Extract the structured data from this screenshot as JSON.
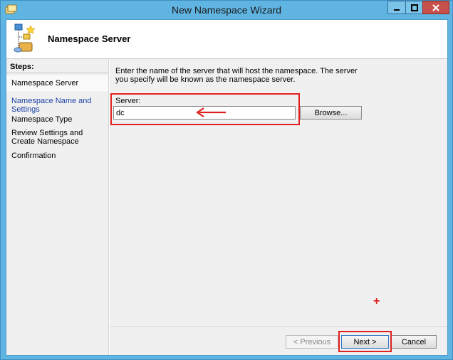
{
  "window": {
    "title": "New Namespace Wizard"
  },
  "header": {
    "title": "Namespace Server"
  },
  "steps": {
    "title": "Steps:",
    "items": [
      {
        "label": "Namespace Server"
      },
      {
        "label": "Namespace Name and Settings"
      },
      {
        "label": "Namespace Type"
      },
      {
        "label": "Review Settings and Create Namespace"
      },
      {
        "label": "Confirmation"
      }
    ]
  },
  "content": {
    "description": "Enter the name of the server that will host the namespace. The server you specify will be known as the namespace server.",
    "server_label": "Server:",
    "server_value": "dc",
    "browse_label": "Browse..."
  },
  "footer": {
    "previous_label": "< Previous",
    "next_label": "Next >",
    "cancel_label": "Cancel"
  },
  "colors": {
    "annotation": "#e02020",
    "link": "#1b3fa5",
    "titlebar": "#5fb4e2"
  }
}
